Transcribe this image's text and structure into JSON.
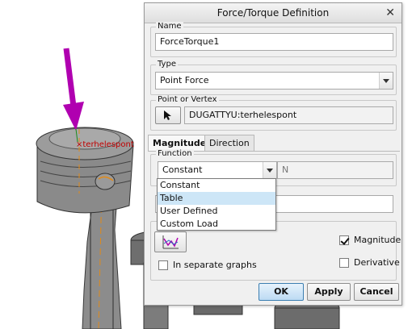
{
  "viewport": {
    "point_label": "terhelespont",
    "point_marker": "×",
    "arrow_color": "#b000b0"
  },
  "dialog": {
    "title": "Force/Torque Definition",
    "close_icon": "close-icon",
    "name": {
      "label": "Name",
      "value": "ForceTorque1"
    },
    "type": {
      "label": "Type",
      "value": "Point Force"
    },
    "point": {
      "label": "Point or Vertex",
      "value": "DUGATTYU:terhelespont",
      "icon": "cursor-arrow-icon"
    },
    "tabs": [
      {
        "label": "Magnitude",
        "active": true
      },
      {
        "label": "Direction",
        "active": false
      }
    ],
    "function": {
      "label": "Function",
      "value": "Constant",
      "unit": "N",
      "options": [
        "Constant",
        "Table",
        "User Defined",
        "Custom Load"
      ],
      "highlighted": "Table"
    },
    "graph_button_icon": "graph-icon",
    "checkboxes": {
      "separate_graphs": {
        "label": "In separate graphs",
        "checked": false
      },
      "magnitude": {
        "label": "Magnitude",
        "checked": true
      },
      "derivative": {
        "label": "Derivative",
        "checked": false
      }
    },
    "buttons": {
      "ok": "OK",
      "apply": "Apply",
      "cancel": "Cancel"
    },
    "accent_color": "#3c7fb1"
  }
}
